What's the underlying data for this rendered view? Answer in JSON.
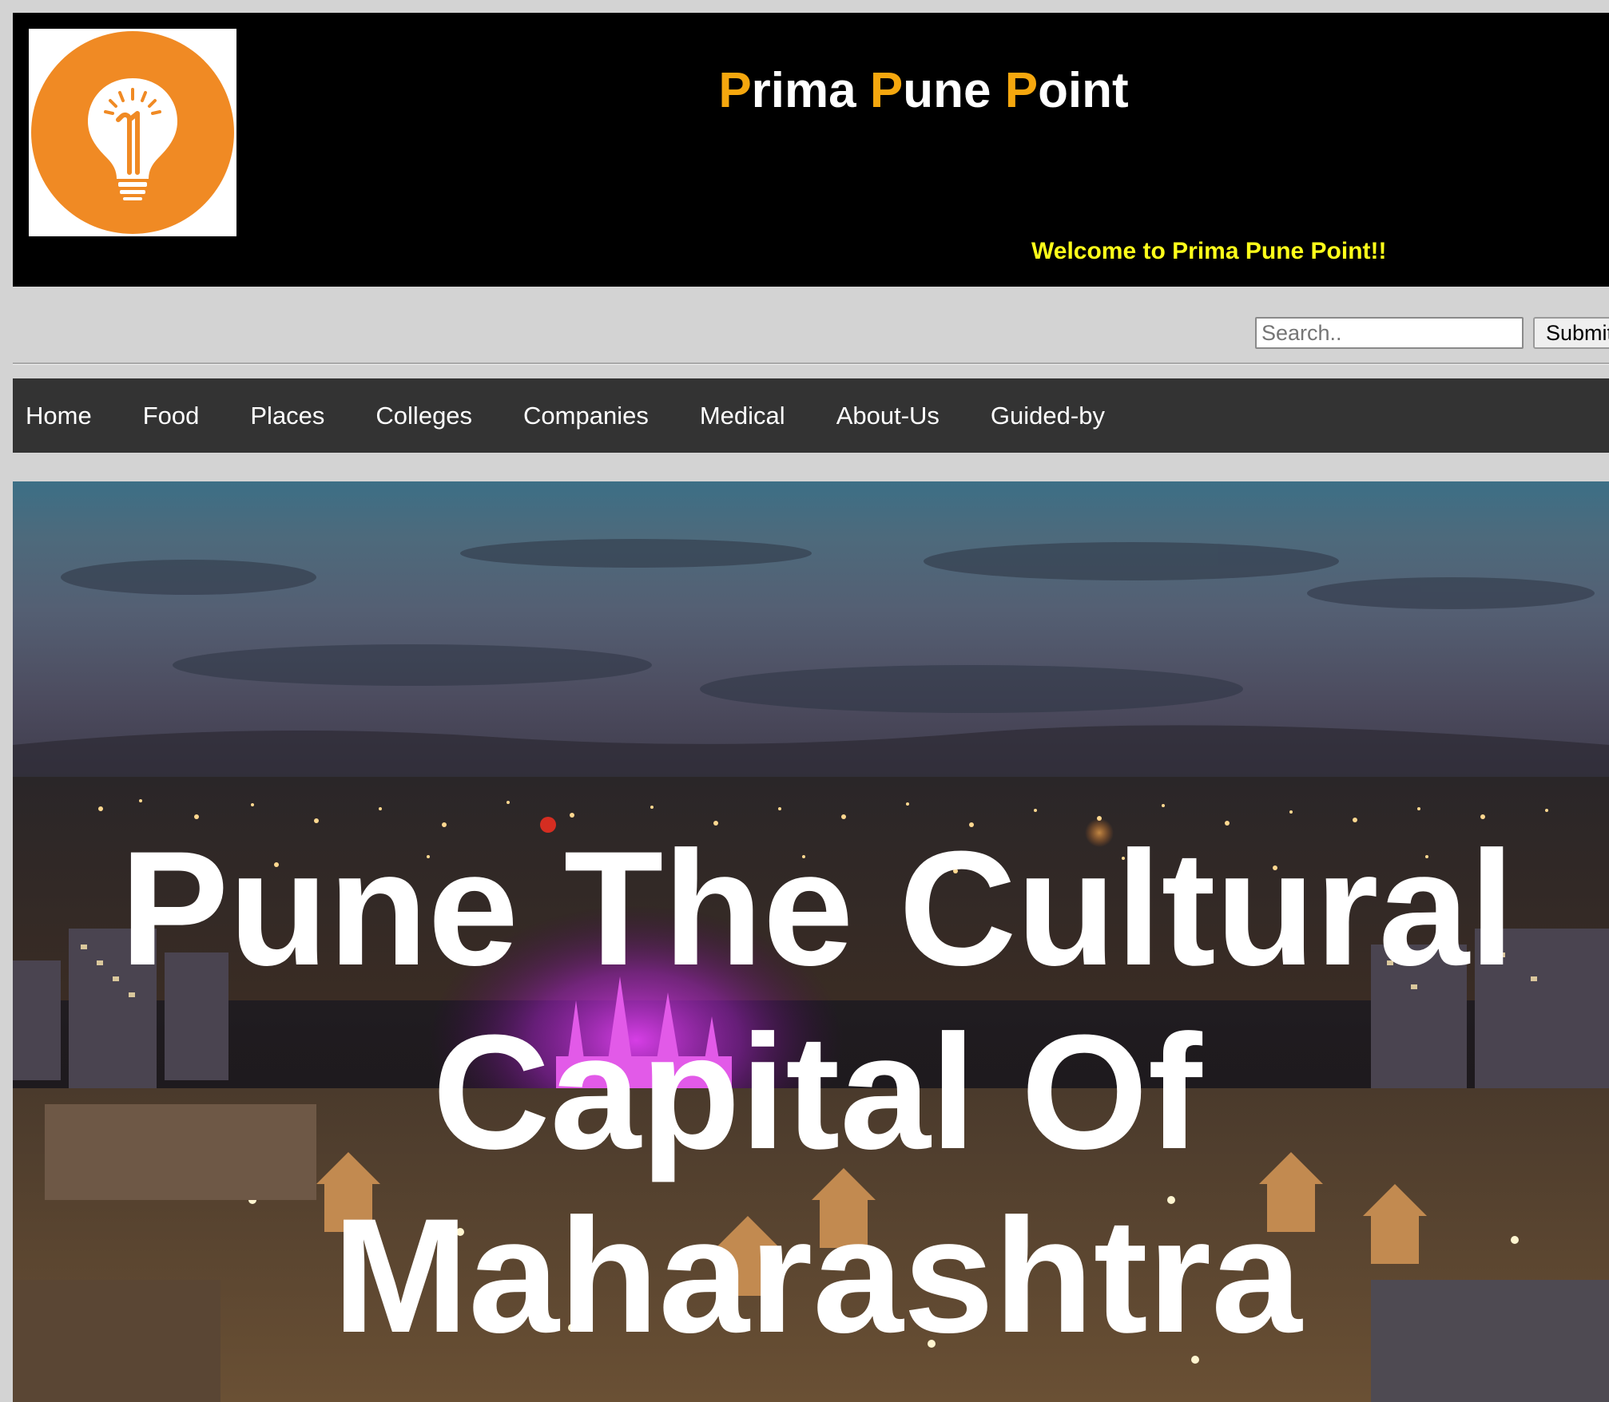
{
  "header": {
    "logo_icon": "lightbulb-icon",
    "title_parts": [
      {
        "initial": "P",
        "rest": "rima"
      },
      {
        "initial": "P",
        "rest": "une"
      },
      {
        "initial": "P",
        "rest": "oint"
      }
    ],
    "welcome": "Welcome to Prima Pune Point!!"
  },
  "search": {
    "placeholder": "Search..",
    "value": "",
    "submit_label": "Submit"
  },
  "nav": {
    "items": [
      "Home",
      "Food",
      "Places",
      "Colleges",
      "Companies",
      "Medical",
      "About-Us",
      "Guided-by"
    ]
  },
  "hero": {
    "title": "Pune The Cultural Capital Of Maharashtra",
    "image": "pune-city-night-skyline"
  },
  "colors": {
    "header_bg": "#000000",
    "title_initial": "#f5a70e",
    "welcome_text": "#ffff1a",
    "nav_bg": "#333333",
    "logo_orange": "#f08a24"
  }
}
